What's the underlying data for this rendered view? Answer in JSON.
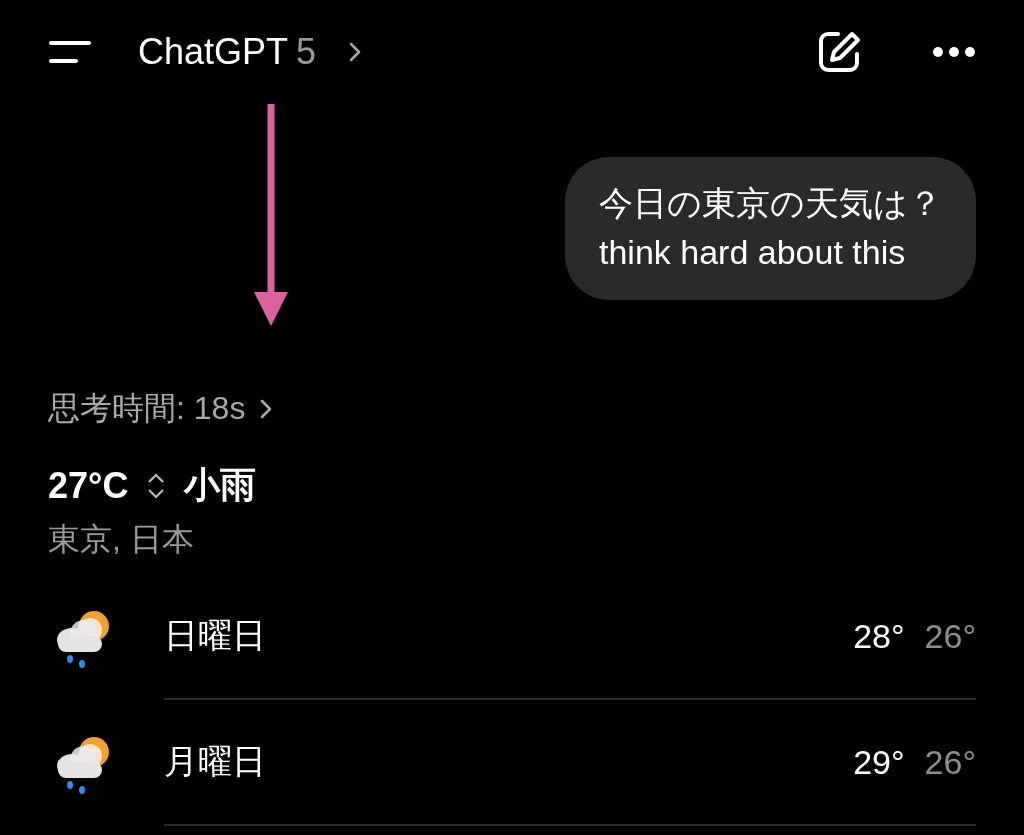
{
  "header": {
    "title": "ChatGPT",
    "model": "5"
  },
  "user_message": {
    "text": "今日の東京の天気は？\nthink hard about this"
  },
  "thinking": {
    "label": "思考時間: 18s"
  },
  "weather": {
    "temperature": "27°C",
    "condition": "小雨",
    "location": "東京, 日本",
    "days": [
      {
        "day": "日曜日",
        "high": "28°",
        "low": "26°"
      },
      {
        "day": "月曜日",
        "high": "29°",
        "low": "26°"
      }
    ]
  }
}
